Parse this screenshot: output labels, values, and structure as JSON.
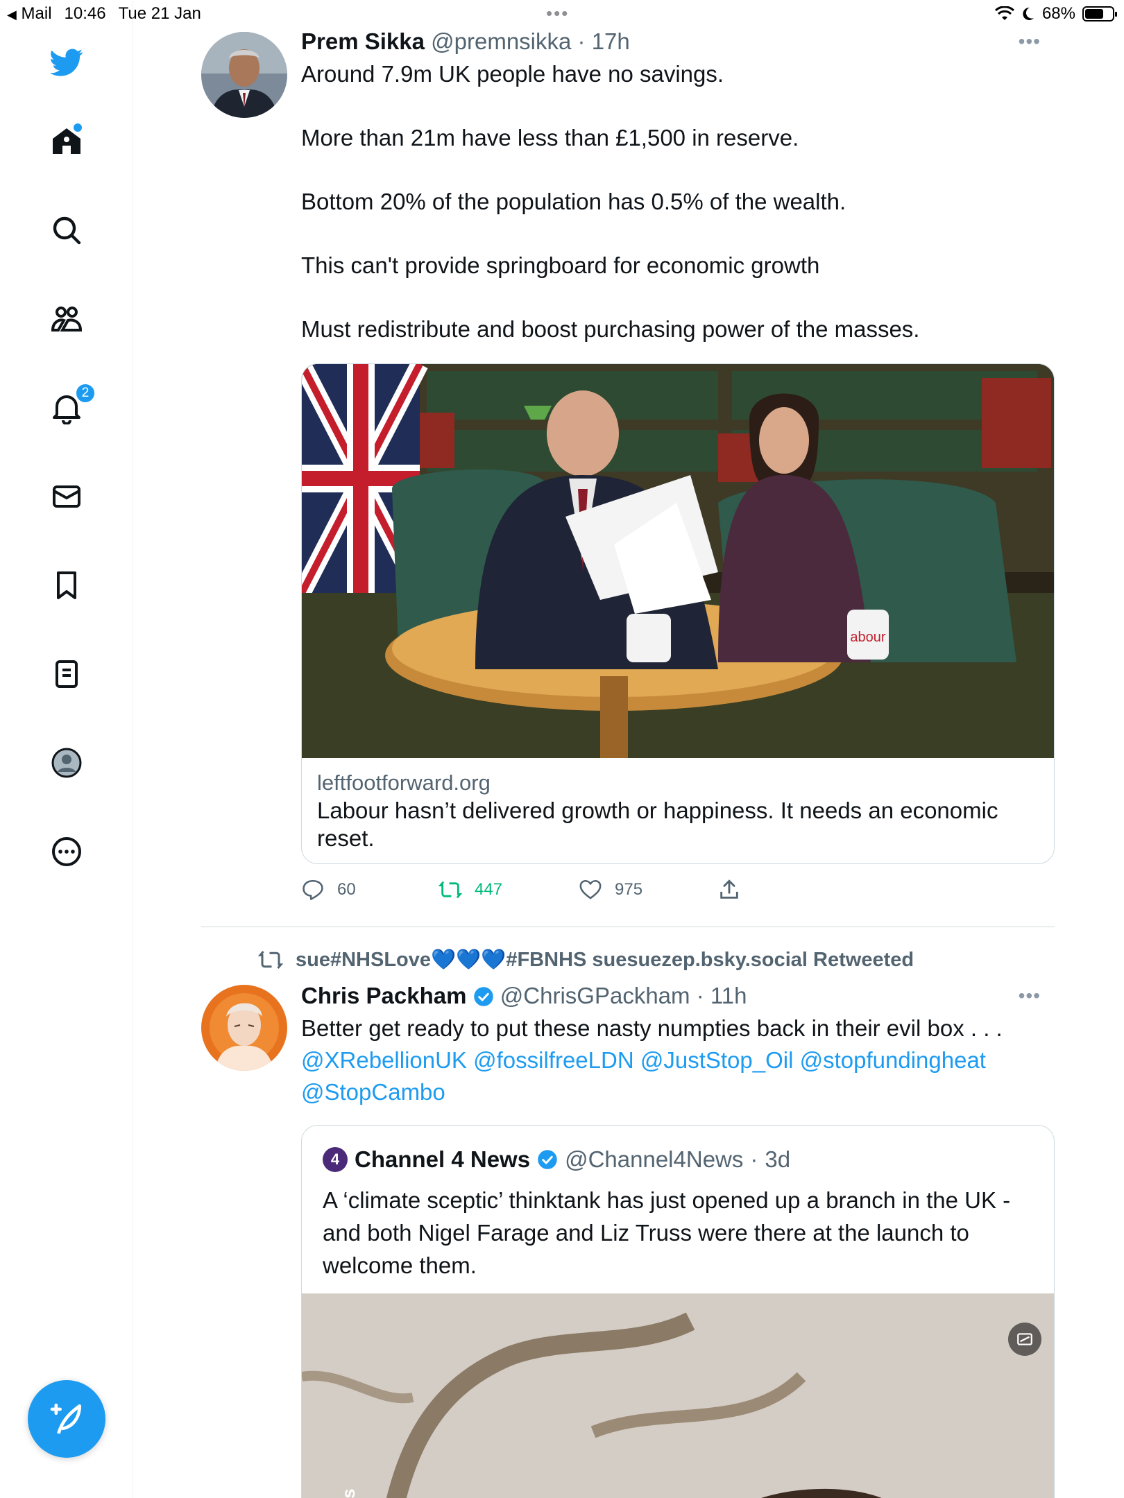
{
  "status_bar": {
    "back_app": "Mail",
    "time": "10:46",
    "date": "Tue 21 Jan",
    "battery": "68%",
    "battery_level": 0.68
  },
  "sidebar": {
    "items": [
      {
        "name": "twitter-logo",
        "label": "Twitter"
      },
      {
        "name": "home",
        "label": "Home"
      },
      {
        "name": "explore",
        "label": "Explore"
      },
      {
        "name": "communities",
        "label": "Communities"
      },
      {
        "name": "notifications",
        "label": "Notifications"
      },
      {
        "name": "messages",
        "label": "Messages"
      },
      {
        "name": "bookmarks",
        "label": "Bookmarks"
      },
      {
        "name": "lists",
        "label": "Lists"
      },
      {
        "name": "profile",
        "label": "Profile"
      },
      {
        "name": "more",
        "label": "More"
      }
    ],
    "notification_count": "2"
  },
  "tweet1": {
    "name": "Prem Sikka",
    "handle": "@premnsikka",
    "time": "17h",
    "paragraphs": [
      "Around 7.9m UK people have no savings.",
      "More than 21m have less than £1,500 in reserve.",
      "Bottom 20% of the population has 0.5% of the wealth.",
      "This can't provide springboard for economic growth",
      "Must redistribute and boost purchasing power of the masses."
    ],
    "card": {
      "domain": "leftfootforward.org",
      "title": "Labour hasn’t delivered growth or happiness. It needs an economic reset.",
      "mug_text": "abour"
    },
    "actions": {
      "replies": "60",
      "retweets": "447",
      "likes": "975"
    }
  },
  "tweet2": {
    "retweeted_by": "sue#NHSLove💙💙💙#FBNHS suesuezep.bsky.social Retweeted",
    "name": "Chris Packham",
    "handle": "@ChrisGPackham",
    "time": "11h",
    "text": "Better get ready to put these nasty numpties back in their evil box . . .",
    "mentions": "@XRebellionUK @fossilfreeLDN @JustStop_Oil @stopfundingheat",
    "mentions2": "@StopCambo",
    "quote": {
      "logo": "4",
      "name": "Channel 4 News",
      "handle": "@Channel4News",
      "time": "3d",
      "text": "A ‘climate sceptic’ thinktank has just opened up a branch in the UK - and both Nigel Farage and Liz Truss were there at the launch to welcome them.",
      "image_credit": "Images"
    }
  },
  "colors": {
    "accent": "#1d9bf0",
    "retweet_green": "#00ba7c",
    "text_secondary": "#536471"
  }
}
